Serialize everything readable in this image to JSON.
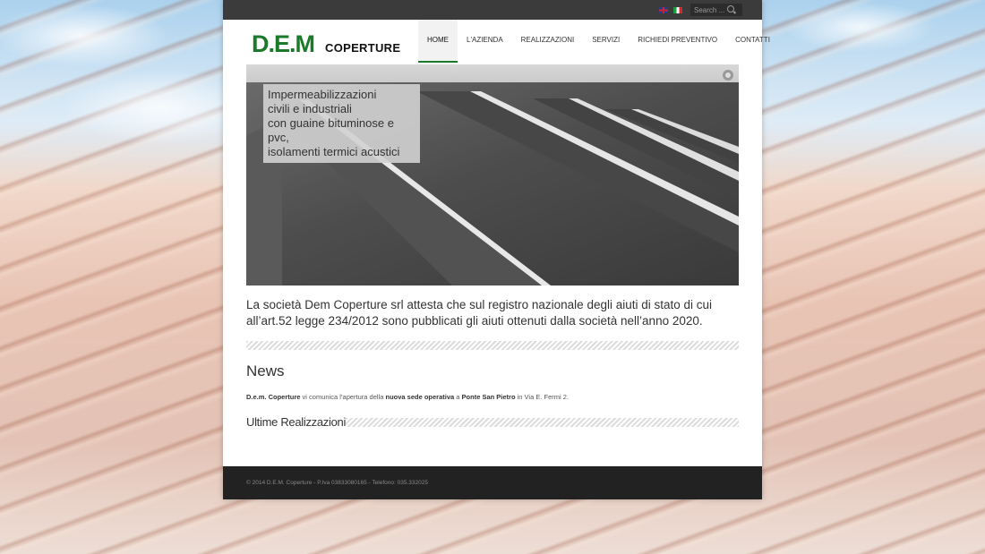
{
  "topbar": {
    "search_placeholder": "Search ...",
    "flags": [
      "en-flag-icon",
      "it-flag-icon"
    ]
  },
  "logo": {
    "mark": "D.E.M",
    "name": "COPERTURE"
  },
  "nav": {
    "items": [
      {
        "label": "HOME",
        "active": true
      },
      {
        "label": "L'AZIENDA",
        "active": false
      },
      {
        "label": "REALIZZAZIONI",
        "active": false
      },
      {
        "label": "SERVIZI",
        "active": false
      },
      {
        "label": "RICHIEDI PREVENTIVO",
        "active": false
      },
      {
        "label": "CONTATTI",
        "active": false
      }
    ]
  },
  "slider": {
    "caption_lines": [
      "Impermeabilizzazioni",
      "civili e industriali",
      "con guaine bituminose e pvc,",
      "isolamenti termici acustici"
    ]
  },
  "intro": {
    "text": "La società Dem Coperture srl attesta che sul registro nazionale degli aiuti di stato di cui all’art.52 legge 234/2012 sono pubblicati gli aiuti ottenuti dalla società nell’anno 2020."
  },
  "news": {
    "title": "News",
    "parts": [
      {
        "text": "D.e.m. Coperture",
        "bold": true
      },
      {
        "text": " vi comunica l’apertura della ",
        "bold": false
      },
      {
        "text": "nuova sede operativa",
        "bold": true
      },
      {
        "text": " a ",
        "bold": false
      },
      {
        "text": "Ponte San Pietro",
        "bold": true
      },
      {
        "text": " in Via E. Fermi 2.",
        "bold": false
      }
    ]
  },
  "ultime": {
    "title": "Ultime Realizzazioni"
  },
  "footer": {
    "text": "© 2014 D.E.M. Coperture - P.Iva 03833080165 - Telefono: 035.332025"
  },
  "colors": {
    "brand_green": "#1a7a2a",
    "topbar": "#3b3b3b",
    "footer": "#222222"
  }
}
